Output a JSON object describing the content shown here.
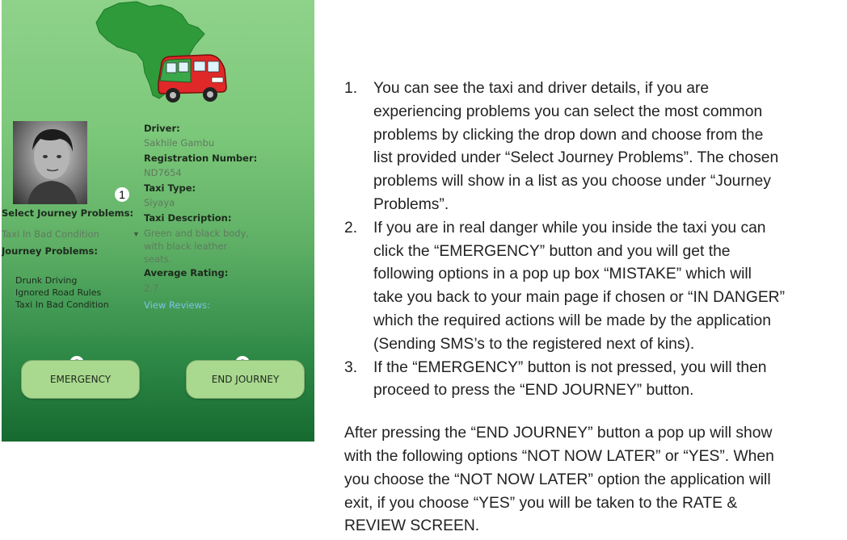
{
  "screen": {
    "driver_label": "Driver:",
    "driver_name": "Sakhile Gambu",
    "registration_label": "Registration Number:",
    "registration_value": "ND7654",
    "taxi_type_label": "Taxi Type:",
    "taxi_type_value": "Siyaya",
    "taxi_description_label": "Taxi Description:",
    "taxi_description_lines": [
      "Green and black body,",
      "with black leather",
      "seats."
    ],
    "average_rating_label": "Average Rating:",
    "average_rating_value": "2.7",
    "view_reviews_link": "View Reviews:",
    "select_problems_label": "Select Journey Problems:",
    "select_problems_value": "Taxi In Bad Condition",
    "journey_problems_label": "Journey Problems:",
    "journey_problems": [
      "Drunk Driving",
      "Ignored Road Rules",
      "Taxi In Bad Condition"
    ],
    "emergency_button": "EMERGENCY",
    "end_journey_button": "END JOURNEY",
    "markers": [
      "1",
      "2",
      "3"
    ],
    "colors": {
      "accent_button": "#a9d88f",
      "map": "#2e9a3a",
      "taxi": "#e02828",
      "link": "#7fc2e8"
    }
  },
  "instructions": {
    "items": [
      {
        "number": "1.",
        "lines": [
          "You can see the taxi and driver details, if you are",
          "experiencing problems you can select the most common",
          "problems by clicking the drop down and choose from the",
          "list provided under “Select Journey Problems”. The chosen",
          "problems will show in a list as you choose under “Journey",
          "Problems”."
        ]
      },
      {
        "number": "2.",
        "lines": [
          "If you are in real danger while you inside the taxi you can",
          "click the “EMERGENCY” button and you will get the",
          "following options in a pop up box “MISTAKE” which will",
          "take you back to your main page if chosen or “IN DANGER”",
          "which the required actions will be made by the application",
          "(Sending SMS’s to the registered next of kins)."
        ]
      },
      {
        "number": "3.",
        "lines": [
          "If the “EMERGENCY” button is not pressed, you will then",
          "proceed to press the “END JOURNEY” button."
        ]
      }
    ],
    "paragraph_lines": [
      "After pressing the “END JOURNEY” button a pop up will show",
      "with the following options “NOT NOW LATER” or “YES”. When",
      "you choose the “NOT NOW LATER” option the application will",
      "exit, if you choose “YES” you will be taken to the RATE &",
      "REVIEW SCREEN."
    ]
  }
}
